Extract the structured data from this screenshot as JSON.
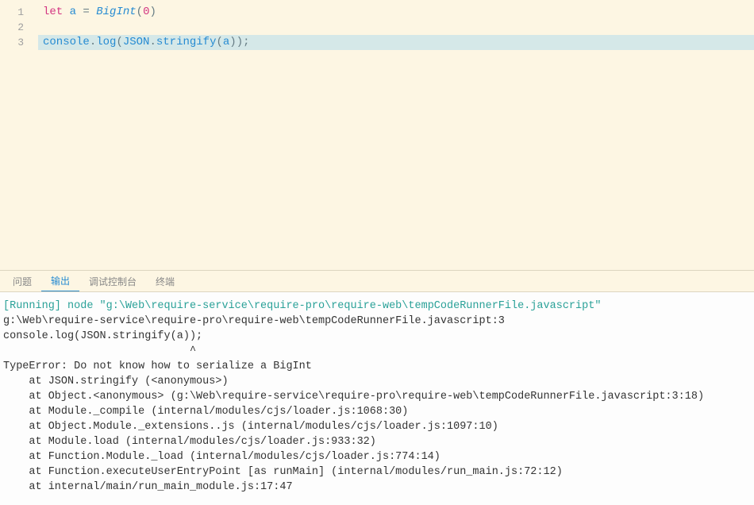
{
  "editor": {
    "lines": [
      {
        "num": "1",
        "highlighted": false
      },
      {
        "num": "2",
        "highlighted": false
      },
      {
        "num": "3",
        "highlighted": true
      }
    ],
    "line1": {
      "kw_let": "let",
      "var_a": "a",
      "eq": " = ",
      "bigint": "BigInt",
      "lparen": "(",
      "zero": "0",
      "rparen": ")"
    },
    "line3": {
      "console": "console",
      "dot1": ".",
      "log": "log",
      "lparen1": "(",
      "json": "JSON",
      "dot2": ".",
      "stringify": "stringify",
      "lparen2": "(",
      "a": "a",
      "rparen2": ")",
      "rparen1": ")",
      "semi": ";"
    }
  },
  "tabs": {
    "problems": "问题",
    "output": "输出",
    "debug": "调试控制台",
    "terminal": "终端"
  },
  "output": {
    "running_label": "[Running] ",
    "running_cmd": "node \"g:\\Web\\require-service\\require-pro\\require-web\\tempCodeRunnerFile.javascript\"",
    "path_line": "g:\\Web\\require-service\\require-pro\\require-web\\tempCodeRunnerFile.javascript:3",
    "code_echo": "console.log(JSON.stringify(a));",
    "caret_line": "                             ^",
    "blank": "",
    "error_title": "TypeError: Do not know how to serialize a BigInt",
    "stack1": "    at JSON.stringify (<anonymous>)",
    "stack2": "    at Object.<anonymous> (g:\\Web\\require-service\\require-pro\\require-web\\tempCodeRunnerFile.javascript:3:18)",
    "stack3": "    at Module._compile (internal/modules/cjs/loader.js:1068:30)",
    "stack4": "    at Object.Module._extensions..js (internal/modules/cjs/loader.js:1097:10)",
    "stack5": "    at Module.load (internal/modules/cjs/loader.js:933:32)",
    "stack6": "    at Function.Module._load (internal/modules/cjs/loader.js:774:14)",
    "stack7": "    at Function.executeUserEntryPoint [as runMain] (internal/modules/run_main.js:72:12)",
    "stack8": "    at internal/main/run_main_module.js:17:47"
  }
}
